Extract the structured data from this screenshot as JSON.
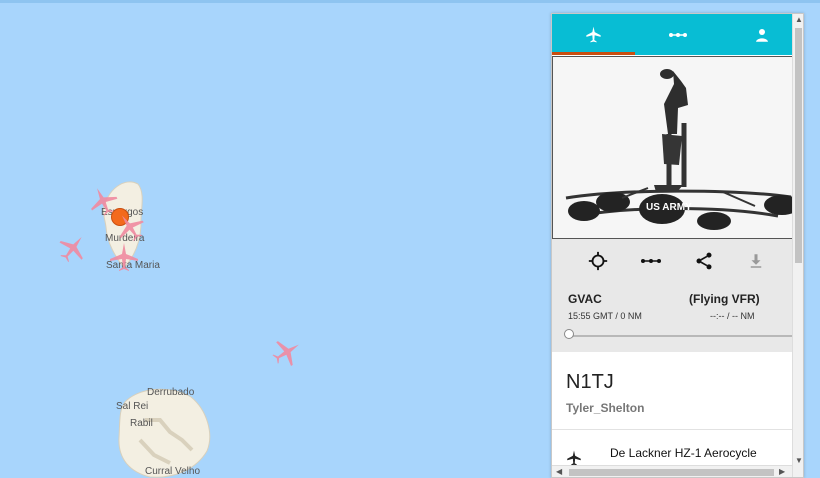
{
  "map": {
    "places": [
      {
        "id": "espargos",
        "label": "Espargos"
      },
      {
        "id": "murdeira",
        "label": "Murdeira"
      },
      {
        "id": "santa-maria",
        "label": "Santa Maria"
      },
      {
        "id": "derrubado",
        "label": "Derrubado"
      },
      {
        "id": "sal-rei",
        "label": "Sal Rei"
      },
      {
        "id": "rabil",
        "label": "Rabil"
      },
      {
        "id": "curral-velho",
        "label": "Curral Velho"
      }
    ],
    "colors": {
      "water": "#a8d5fc",
      "land": "#f3efe2",
      "plane": "#f08aa0",
      "poi": "#f36a1d"
    }
  },
  "panel": {
    "tabs": [
      {
        "label": "Flight",
        "icon": "airplane-icon",
        "active": true
      },
      {
        "label": "Route",
        "icon": "route-icon",
        "active": false
      },
      {
        "label": "Pilot",
        "icon": "user-icon",
        "active": false
      }
    ],
    "photo": {
      "icon": "aircraft-photo",
      "overlay_text": "US ARMY"
    },
    "toolbar": [
      {
        "name": "locate-button",
        "icon": "crosshair-icon"
      },
      {
        "name": "route-button",
        "icon": "route-icon"
      },
      {
        "name": "share-button",
        "icon": "share-icon"
      },
      {
        "name": "download-button",
        "icon": "download-icon"
      }
    ],
    "route": {
      "origin": "GVAC",
      "destination": "(Flying VFR)",
      "origin_status": "15:55 GMT / 0 NM",
      "destination_status": "--:-- / -- NM"
    },
    "flight": {
      "callsign": "N1TJ",
      "pilot": "Tyler_Shelton",
      "aircraft": "De Lackner HZ-1 Aerocycle"
    },
    "colors": {
      "accent": "#08bdd4",
      "active_tab": "#c94e10"
    }
  }
}
